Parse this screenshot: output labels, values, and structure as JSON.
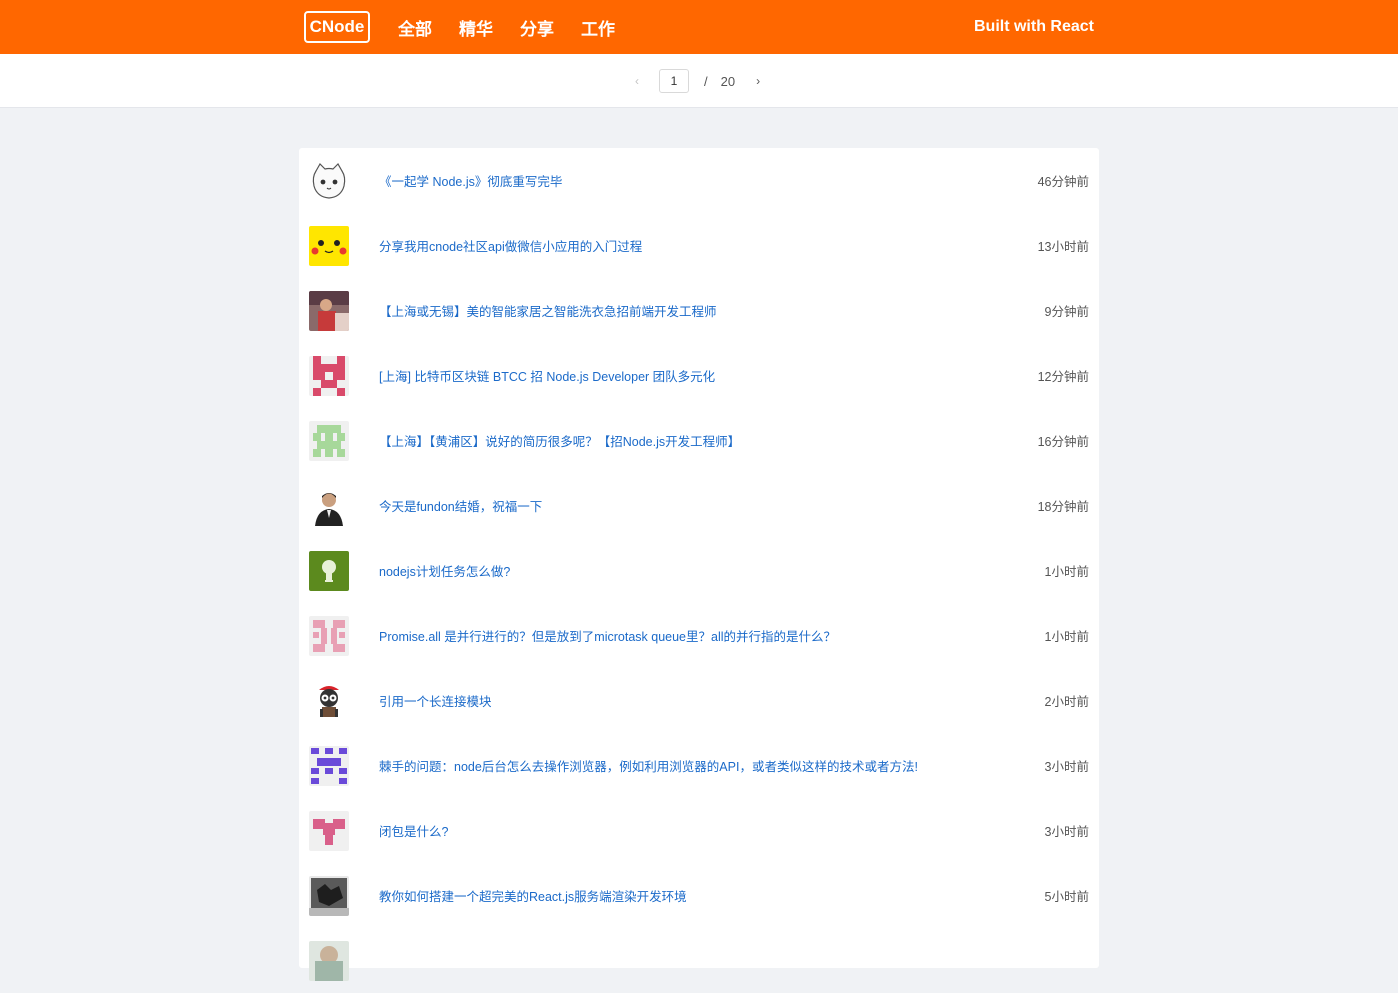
{
  "header": {
    "logo": "CNode",
    "nav": [
      "全部",
      "精华",
      "分享",
      "工作"
    ],
    "built_with": "Built with React",
    "brand_color": "#ff6700"
  },
  "pagination": {
    "prev_icon": "chevron-left-icon",
    "current_page": "1",
    "separator": "/",
    "total_pages": "20",
    "next_icon": "chevron-right-icon"
  },
  "topics": [
    {
      "title": "《一起学 Node.js》彻底重写完毕",
      "time": "46分钟前",
      "avatar": "cat-avatar"
    },
    {
      "title": "分享我用cnode社区api做微信小应用的入门过程",
      "time": "13小时前",
      "avatar": "pikachu-avatar"
    },
    {
      "title": "【上海或无锡】美的智能家居之智能洗衣急招前端开发工程师",
      "time": "9分钟前",
      "avatar": "photo-avatar"
    },
    {
      "title": "[上海] 比特币区块链 BTCC 招 Node.js Developer 团队多元化",
      "time": "12分钟前",
      "avatar": "identicon-avatar"
    },
    {
      "title": "【上海】【黄浦区】说好的简历很多呢？【招Node.js开发工程师】",
      "time": "16分钟前",
      "avatar": "identicon-avatar"
    },
    {
      "title": "今天是fundon结婚，祝福一下",
      "time": "18分钟前",
      "avatar": "person-avatar"
    },
    {
      "title": "nodejs计划任务怎么做?",
      "time": "1小时前",
      "avatar": "green-avatar"
    },
    {
      "title": "Promise.all 是并行进行的？但是放到了microtask queue里？all的并行指的是什么？",
      "time": "1小时前",
      "avatar": "identicon-avatar"
    },
    {
      "title": "引用一个长连接模块",
      "time": "2小时前",
      "avatar": "octocat-avatar"
    },
    {
      "title": "棘手的问题：node后台怎么去操作浏览器，例如利用浏览器的API，或者类似这样的技术或者方法!",
      "time": "3小时前",
      "avatar": "identicon-avatar"
    },
    {
      "title": "闭包是什么?",
      "time": "3小时前",
      "avatar": "identicon-avatar"
    },
    {
      "title": "教你如何搭建一个超完美的React.js服务端渲染开发环境",
      "time": "5小时前",
      "avatar": "photo-avatar"
    }
  ]
}
